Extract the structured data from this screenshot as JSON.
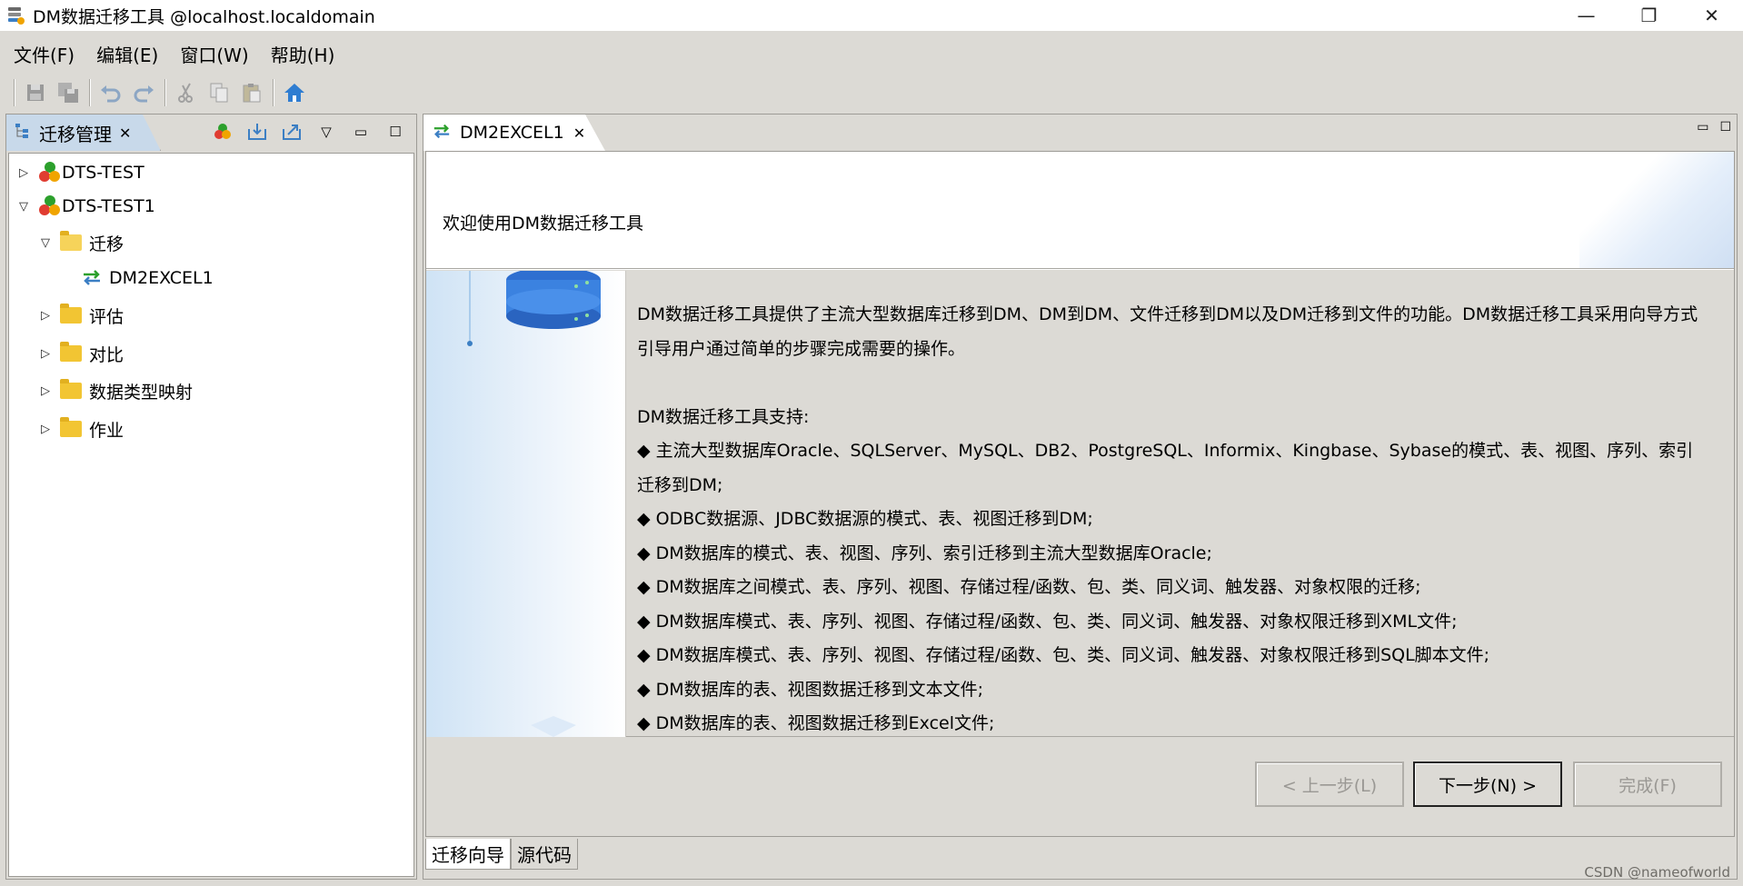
{
  "window": {
    "title": "DM数据迁移工具 @localhost.localdomain",
    "icon": "database-stack-icon",
    "controls": {
      "minimize": "—",
      "restore": "❐",
      "close": "✕"
    }
  },
  "menubar": {
    "items": [
      "文件(F)",
      "编辑(E)",
      "窗口(W)",
      "帮助(H)"
    ]
  },
  "toolbar": {
    "buttons": [
      "save-icon",
      "save-all-icon",
      "undo-icon",
      "redo-icon",
      "cut-icon",
      "copy-icon",
      "paste-icon",
      "home-icon"
    ]
  },
  "left_panel": {
    "tab_label": "迁移管理",
    "tab_close": "✕",
    "tree": [
      {
        "label": "DTS-TEST",
        "expanded": false,
        "level": 0,
        "type": "project"
      },
      {
        "label": "DTS-TEST1",
        "expanded": true,
        "level": 0,
        "type": "project"
      },
      {
        "label": "迁移",
        "expanded": true,
        "level": 1,
        "type": "folder"
      },
      {
        "label": "DM2EXCEL1",
        "level": 2,
        "type": "migration"
      },
      {
        "label": "评估",
        "expanded": false,
        "level": 1,
        "type": "folder"
      },
      {
        "label": "对比",
        "expanded": false,
        "level": 1,
        "type": "folder"
      },
      {
        "label": "数据类型映射",
        "expanded": false,
        "level": 1,
        "type": "folder"
      },
      {
        "label": "作业",
        "expanded": false,
        "level": 1,
        "type": "folder"
      }
    ]
  },
  "editor": {
    "tab_label": "DM2EXCEL1",
    "tab_close": "✕",
    "header_title": "欢迎使用DM数据迁移工具",
    "intro_lines": [
      "DM数据迁移工具提供了主流大型数据库迁移到DM、DM到DM、文件迁移到DM以及DM迁移到文件的功能。DM数据迁移工具采用向导方式",
      "引导用户通过简单的步骤完成需要的操作。"
    ],
    "support_heading": "DM数据迁移工具支持:",
    "support_lines": [
      "◆ 主流大型数据库Oracle、SQLServer、MySQL、DB2、PostgreSQL、Informix、Kingbase、Sybase的模式、表、视图、序列、索引",
      "迁移到DM;",
      "◆ ODBC数据源、JDBC数据源的模式、表、视图迁移到DM;",
      "◆ DM数据库的模式、表、视图、序列、索引迁移到主流大型数据库Oracle;",
      "◆ DM数据库之间模式、表、序列、视图、存储过程/函数、包、类、同义词、触发器、对象权限的迁移;",
      "◆ DM数据库模式、表、序列、视图、存储过程/函数、包、类、同义词、触发器、对象权限迁移到XML文件;",
      "◆ DM数据库模式、表、序列、视图、存储过程/函数、包、类、同义词、触发器、对象权限迁移到SQL脚本文件;",
      "◆ DM数据库的表、视图数据迁移到文本文件;",
      "◆ DM数据库的表、视图数据迁移到Excel文件;"
    ],
    "buttons": {
      "back": "< 上一步(L)",
      "next": "下一步(N) >",
      "finish": "完成(F)"
    },
    "bottom_tabs": [
      "迁移向导",
      "源代码"
    ]
  },
  "watermark": "CSDN @nameofworld"
}
